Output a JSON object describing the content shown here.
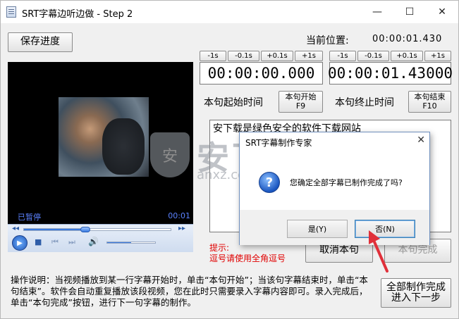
{
  "window": {
    "title": "SRT字幕边听边做 - Step 2",
    "minimize": "—",
    "maximize": "☐",
    "close": "✕"
  },
  "toolbar": {
    "save_label": "保存进度",
    "position_label": "当前位置:",
    "position_value": "00:00:01.430"
  },
  "start": {
    "adjust": [
      "-1s",
      "-0.1s",
      "+0.1s",
      "+1s"
    ],
    "time": "00:00:00.000",
    "label": "本句起始时间",
    "button_line1": "本句开始",
    "button_line2": "F9"
  },
  "end": {
    "adjust": [
      "-1s",
      "-0.1s",
      "+0.1s",
      "+1s"
    ],
    "time": "00:00:01.43000",
    "label": "本句终止时间",
    "button_line1": "本句结束",
    "button_line2": "F10"
  },
  "video": {
    "status": "已暂停",
    "time": "00:01",
    "seek_progress": 0.42,
    "volume": 0.5
  },
  "subtitle_text": "安下载是绿色安全的软件下载网站",
  "hint": {
    "line1": "提示:",
    "line2": "逗号请使用全角逗号"
  },
  "buttons": {
    "cancel_sentence": "取消本句",
    "sentence_done": "本句完成",
    "finish_line1": "全部制作完成",
    "finish_line2": "进入下一步"
  },
  "instructions": "操作说明：当视频播放到某一行字幕开始时，单击“本句开始”；当该句字幕结束时，单击“本句结束”。软件会自动重复播放该段视频，您在此时只需要录入字幕内容即可。录入完成后，单击“本句完成”按钮，进行下一句字幕的制作。",
  "watermark": {
    "text": "安下载",
    "sub": "anxz.com",
    "shield": "安"
  },
  "dialog": {
    "title": "SRT字幕制作专家",
    "close": "✕",
    "icon": "?",
    "message": "您确定全部字幕已制作完成了吗?",
    "yes": "是(Y)",
    "no": "否(N)"
  },
  "colors": {
    "hint": "#e00000",
    "video_status": "#5b82ff",
    "annotation_arrow": "#e0303a"
  }
}
